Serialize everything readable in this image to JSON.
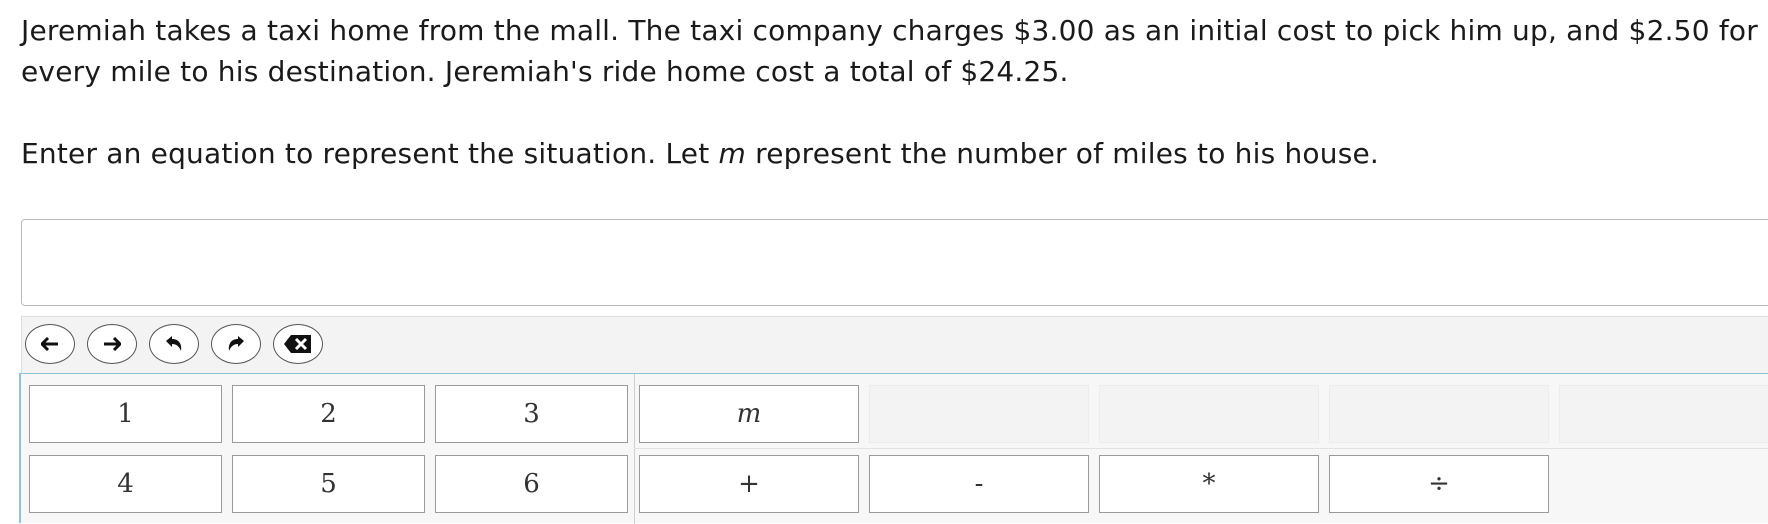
{
  "question": {
    "statement": "Jeremiah takes a taxi home from the mall. The taxi company charges $3.00 as an initial cost to pick him up, and $2.50 for every mile to his destination. Jeremiah's ride home cost a total of $24.25.",
    "prompt_before": "Enter an equation to represent the situation. Let ",
    "variable": "m",
    "prompt_after": " represent the number of miles to his house."
  },
  "answer": {
    "value": ""
  },
  "toolbar": [
    {
      "name": "move-left-button",
      "icon": "arrow-left-icon"
    },
    {
      "name": "move-right-button",
      "icon": "arrow-right-icon"
    },
    {
      "name": "undo-button",
      "icon": "undo-icon"
    },
    {
      "name": "redo-button",
      "icon": "redo-icon"
    },
    {
      "name": "backspace-button",
      "icon": "backspace-icon"
    }
  ],
  "keypad": {
    "row1": [
      "1",
      "2",
      "3",
      "m"
    ],
    "row2": [
      "4",
      "5",
      "6",
      "+",
      "-",
      "*",
      "÷"
    ]
  },
  "colors": {
    "keypad_border": "#8ec4d9",
    "toolbar_bg": "#f3f3f3"
  }
}
